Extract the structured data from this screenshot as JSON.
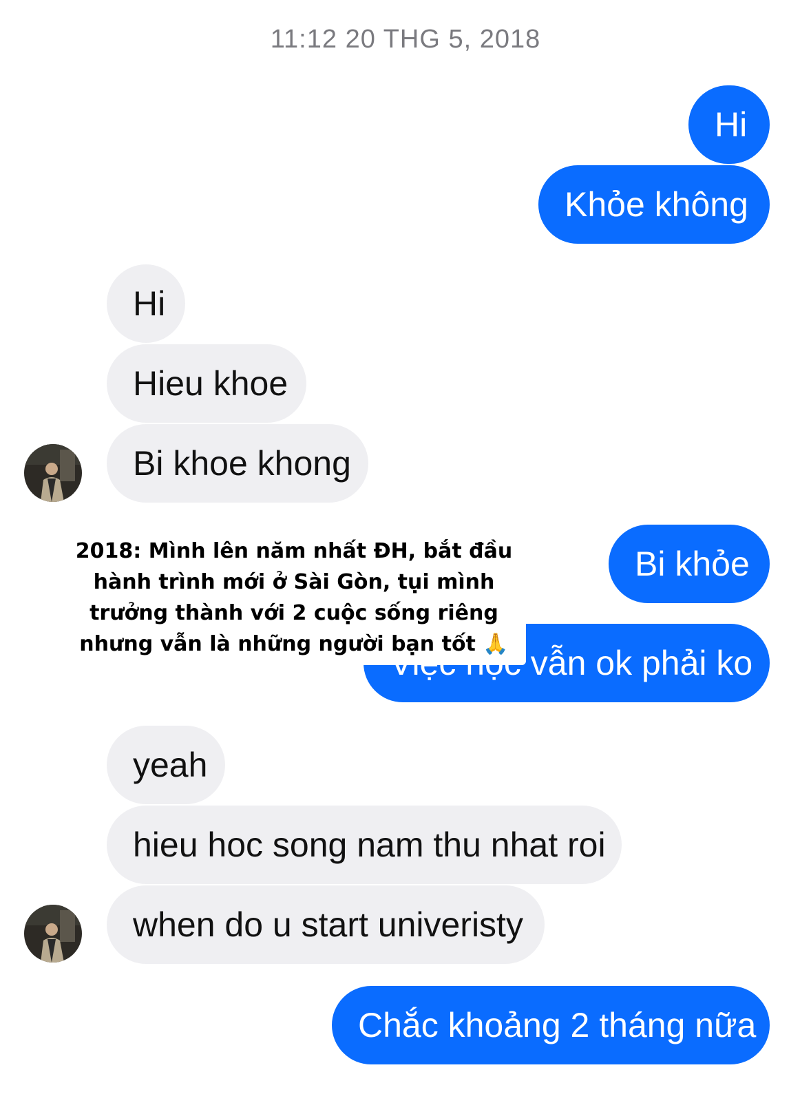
{
  "conversation": {
    "timestamp": "11:12 20 THG 5, 2018",
    "messages": [
      {
        "sender": "me",
        "text": "Hi"
      },
      {
        "sender": "me",
        "text": "Khỏe không"
      },
      {
        "sender": "them",
        "text": "Hi"
      },
      {
        "sender": "them",
        "text": "Hieu khoe"
      },
      {
        "sender": "them",
        "text": "Bi khoe khong"
      },
      {
        "sender": "me",
        "text": "Bi khỏe"
      },
      {
        "sender": "me",
        "text": "Việc học vẫn ok phải ko"
      },
      {
        "sender": "them",
        "text": "yeah"
      },
      {
        "sender": "them",
        "text": "hieu hoc song nam thu nhat roi"
      },
      {
        "sender": "them",
        "text": "when do u start univeristy"
      },
      {
        "sender": "me",
        "text": "Chắc khoảng 2 tháng nữa"
      }
    ]
  },
  "caption": {
    "lines": [
      "2018: Mình lên năm nhất ĐH, bắt đầu",
      "hành trình mới ở Sài Gòn, tụi mình",
      "trưởng thành với 2 cuộc sống riêng",
      "nhưng vẫn là những người bạn tốt 🙏"
    ]
  },
  "colors": {
    "outgoing_bubble": "#0a6cff",
    "incoming_bubble": "#efeff2",
    "timestamp_text": "#7a7a7f"
  }
}
